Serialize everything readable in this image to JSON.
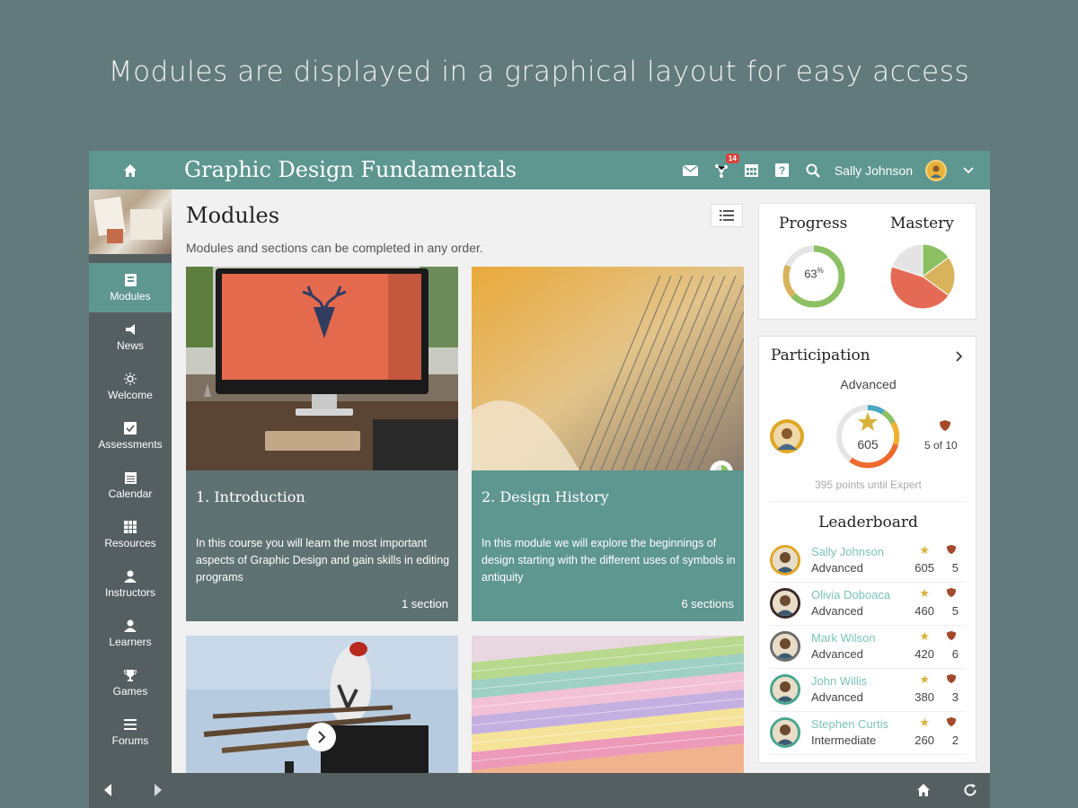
{
  "headline": "Modules are displayed in a graphical layout for easy access",
  "topbar": {
    "course_title": "Graphic Design Fundamentals",
    "notification_count": "14",
    "user_name": "Sally Johnson",
    "accent_color": "#5e9690"
  },
  "sidebar": {
    "items": [
      {
        "label": "Modules",
        "icon": "modules-icon",
        "active": true
      },
      {
        "label": "News",
        "icon": "megaphone-icon"
      },
      {
        "label": "Welcome",
        "icon": "sun-icon"
      },
      {
        "label": "Assessments",
        "icon": "checkbox-icon"
      },
      {
        "label": "Calendar",
        "icon": "calendar-icon"
      },
      {
        "label": "Resources",
        "icon": "grid-icon"
      },
      {
        "label": "Instructors",
        "icon": "person-icon"
      },
      {
        "label": "Learners",
        "icon": "person-icon"
      },
      {
        "label": "Games",
        "icon": "trophy-icon"
      },
      {
        "label": "Forums",
        "icon": "forums-icon"
      }
    ]
  },
  "main": {
    "title": "Modules",
    "subtitle": "Modules and sections can be completed in any order.",
    "cards": [
      {
        "title": "1. Introduction",
        "description": "In this course you will learn the most important aspects of Graphic Design and gain skills in editing programs",
        "sections": "1 section"
      },
      {
        "title": "2. Design History",
        "description": "In this module we will explore the beginnings of design starting with the different uses of symbols in antiquity",
        "sections": "6 sections"
      }
    ]
  },
  "progress": {
    "title": "Progress",
    "value_label": "63",
    "percent_sign": "%",
    "value": 63
  },
  "mastery": {
    "title": "Mastery",
    "slices": [
      {
        "color": "#8cc063",
        "value": 15
      },
      {
        "color": "#d9b35b",
        "value": 20
      },
      {
        "color": "#e46a55",
        "value": 45
      },
      {
        "color": "#e4e4e4",
        "value": 20
      }
    ]
  },
  "participation": {
    "title": "Participation",
    "level": "Advanced",
    "points": "605",
    "badges": "5 of 10",
    "until_next": "395 points until Expert"
  },
  "leaderboard": {
    "title": "Leaderboard",
    "rows": [
      {
        "name": "Sally Johnson",
        "level": "Advanced",
        "points": "605",
        "badges": "5",
        "ring": "#e0a623"
      },
      {
        "name": "Olivia Doboaca",
        "level": "Advanced",
        "points": "460",
        "badges": "5",
        "ring": "#3a2a2a"
      },
      {
        "name": "Mark Wilson",
        "level": "Advanced",
        "points": "420",
        "badges": "6",
        "ring": "#6d6d6d"
      },
      {
        "name": "John Willis",
        "level": "Advanced",
        "points": "380",
        "badges": "3",
        "ring": "#4aa68f"
      },
      {
        "name": "Stephen Curtis",
        "level": "Intermediate",
        "points": "260",
        "badges": "2",
        "ring": "#4aa68f"
      }
    ]
  }
}
